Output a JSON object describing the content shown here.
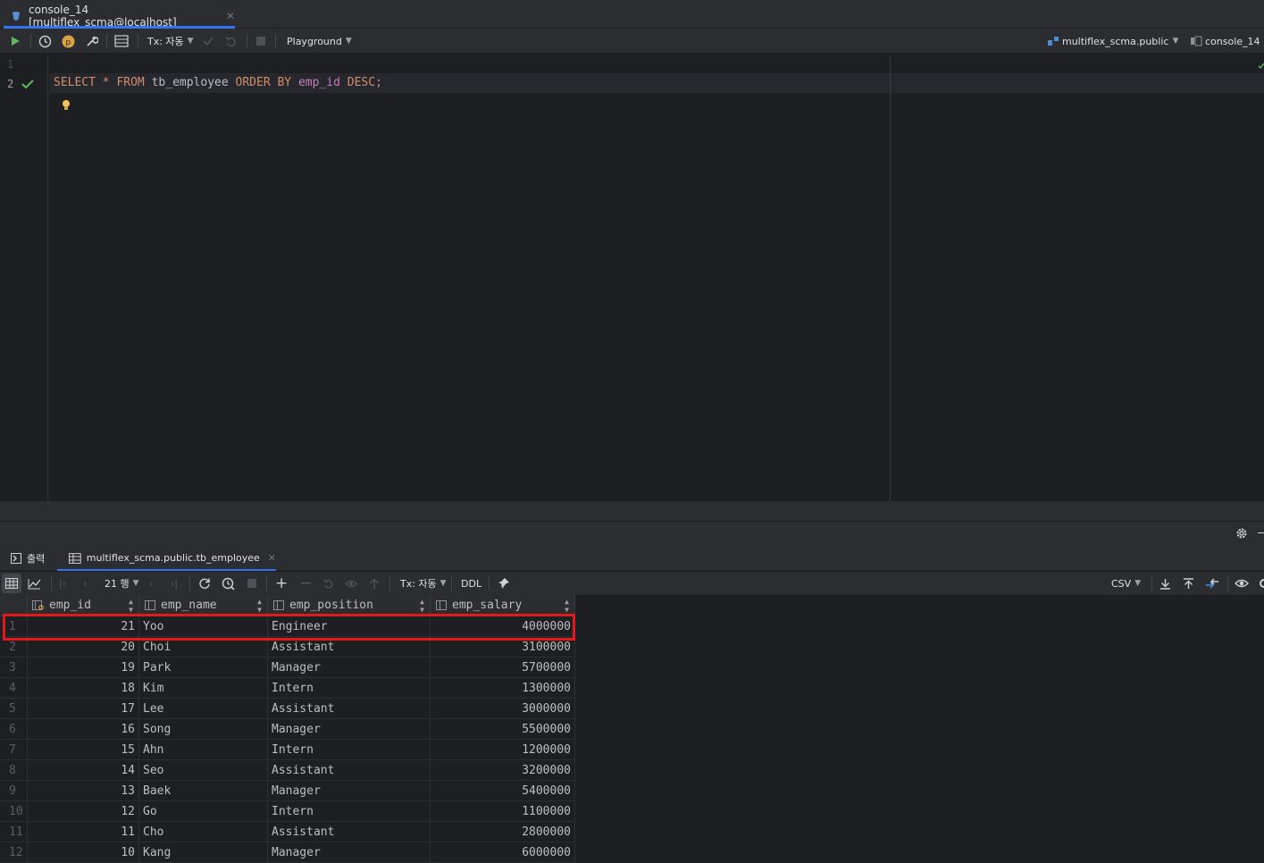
{
  "editor_tab": {
    "label": "console_14 [multiflex_scma@localhost]"
  },
  "toolbar": {
    "tx_label": "Tx: 자동",
    "playground_label": "Playground",
    "schema_label": "multiflex_scma.public",
    "console_label": "console_14"
  },
  "editor": {
    "line_numbers": [
      "1",
      "2"
    ],
    "code": {
      "select": "SELECT",
      "star": " * ",
      "from": "FROM",
      "table": " tb_employee ",
      "order_by": "ORDER BY",
      "column": " emp_id ",
      "desc": "DESC",
      "semicolon": ";"
    }
  },
  "results_tabs": {
    "output": "출력",
    "table": "multiflex_scma.public.tb_employee"
  },
  "results_toolbar": {
    "rows_label": "21 행",
    "tx_label": "Tx: 자동",
    "ddl_label": "DDL",
    "export_label": "CSV"
  },
  "grid": {
    "columns": [
      "emp_id",
      "emp_name",
      "emp_position",
      "emp_salary"
    ],
    "rows": [
      {
        "rn": "1",
        "emp_id": "21",
        "emp_name": "Yoo",
        "emp_position": "Engineer",
        "emp_salary": "4000000"
      },
      {
        "rn": "2",
        "emp_id": "20",
        "emp_name": "Choi",
        "emp_position": "Assistant",
        "emp_salary": "3100000"
      },
      {
        "rn": "3",
        "emp_id": "19",
        "emp_name": "Park",
        "emp_position": "Manager",
        "emp_salary": "5700000"
      },
      {
        "rn": "4",
        "emp_id": "18",
        "emp_name": "Kim",
        "emp_position": "Intern",
        "emp_salary": "1300000"
      },
      {
        "rn": "5",
        "emp_id": "17",
        "emp_name": "Lee",
        "emp_position": "Assistant",
        "emp_salary": "3000000"
      },
      {
        "rn": "6",
        "emp_id": "16",
        "emp_name": "Song",
        "emp_position": "Manager",
        "emp_salary": "5500000"
      },
      {
        "rn": "7",
        "emp_id": "15",
        "emp_name": "Ahn",
        "emp_position": "Intern",
        "emp_salary": "1200000"
      },
      {
        "rn": "8",
        "emp_id": "14",
        "emp_name": "Seo",
        "emp_position": "Assistant",
        "emp_salary": "3200000"
      },
      {
        "rn": "9",
        "emp_id": "13",
        "emp_name": "Baek",
        "emp_position": "Manager",
        "emp_salary": "5400000"
      },
      {
        "rn": "10",
        "emp_id": "12",
        "emp_name": "Go",
        "emp_position": "Intern",
        "emp_salary": "1100000"
      },
      {
        "rn": "11",
        "emp_id": "11",
        "emp_name": "Cho",
        "emp_position": "Assistant",
        "emp_salary": "2800000"
      },
      {
        "rn": "12",
        "emp_id": "10",
        "emp_name": "Kang",
        "emp_position": "Manager",
        "emp_salary": "6000000"
      }
    ]
  },
  "colors": {
    "keyword": "#cf8e6d",
    "column": "#c77dbb",
    "run": "#5fb85c",
    "highlight": "#e5181b",
    "accent": "#3574f0"
  }
}
